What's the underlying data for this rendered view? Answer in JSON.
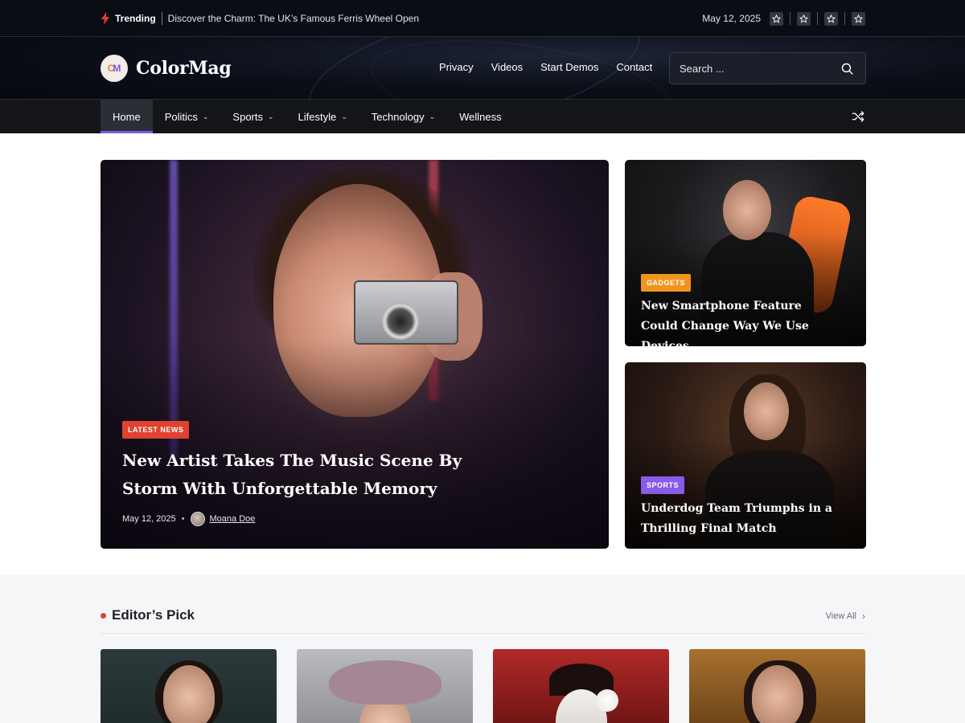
{
  "topbar": {
    "trending_label": "Trending",
    "trending_headline": "Discover the Charm: The UK’s Famous Ferris Wheel Open",
    "date": "May 12, 2025",
    "social_icons": [
      "star-icon",
      "star-icon",
      "star-icon",
      "star-icon"
    ]
  },
  "header": {
    "logo_mark": {
      "c": "C",
      "m": "M"
    },
    "site_name": "ColorMag",
    "nav": [
      "Privacy",
      "Videos",
      "Start Demos",
      "Contact"
    ],
    "search_placeholder": "Search ..."
  },
  "mainnav": {
    "items": [
      {
        "label": "Home",
        "active": true,
        "dropdown": false
      },
      {
        "label": "Politics",
        "dropdown": true
      },
      {
        "label": "Sports",
        "dropdown": true
      },
      {
        "label": "Lifestyle",
        "dropdown": true
      },
      {
        "label": "Technology",
        "dropdown": true
      },
      {
        "label": "Wellness",
        "dropdown": false
      }
    ],
    "accent_color": "#7b5ce6"
  },
  "hero": {
    "category": "LATEST NEWS",
    "category_color": "#e0422f",
    "title": "New Artist Takes The Music Scene By Storm With Unforgettable Memory",
    "date": "May 12, 2025",
    "author": "Moana Doe"
  },
  "side_posts": [
    {
      "category": "GADGETS",
      "category_color": "#f0951c",
      "title": "New Smartphone Feature Could Change Way We Use Devices"
    },
    {
      "category": "SPORTS",
      "category_color": "#8a5ae8",
      "title": "Underdog Team Triumphs in a Thrilling Final Match"
    }
  ],
  "editors_pick": {
    "title": "Editor’s Pick",
    "view_all": "View All"
  }
}
